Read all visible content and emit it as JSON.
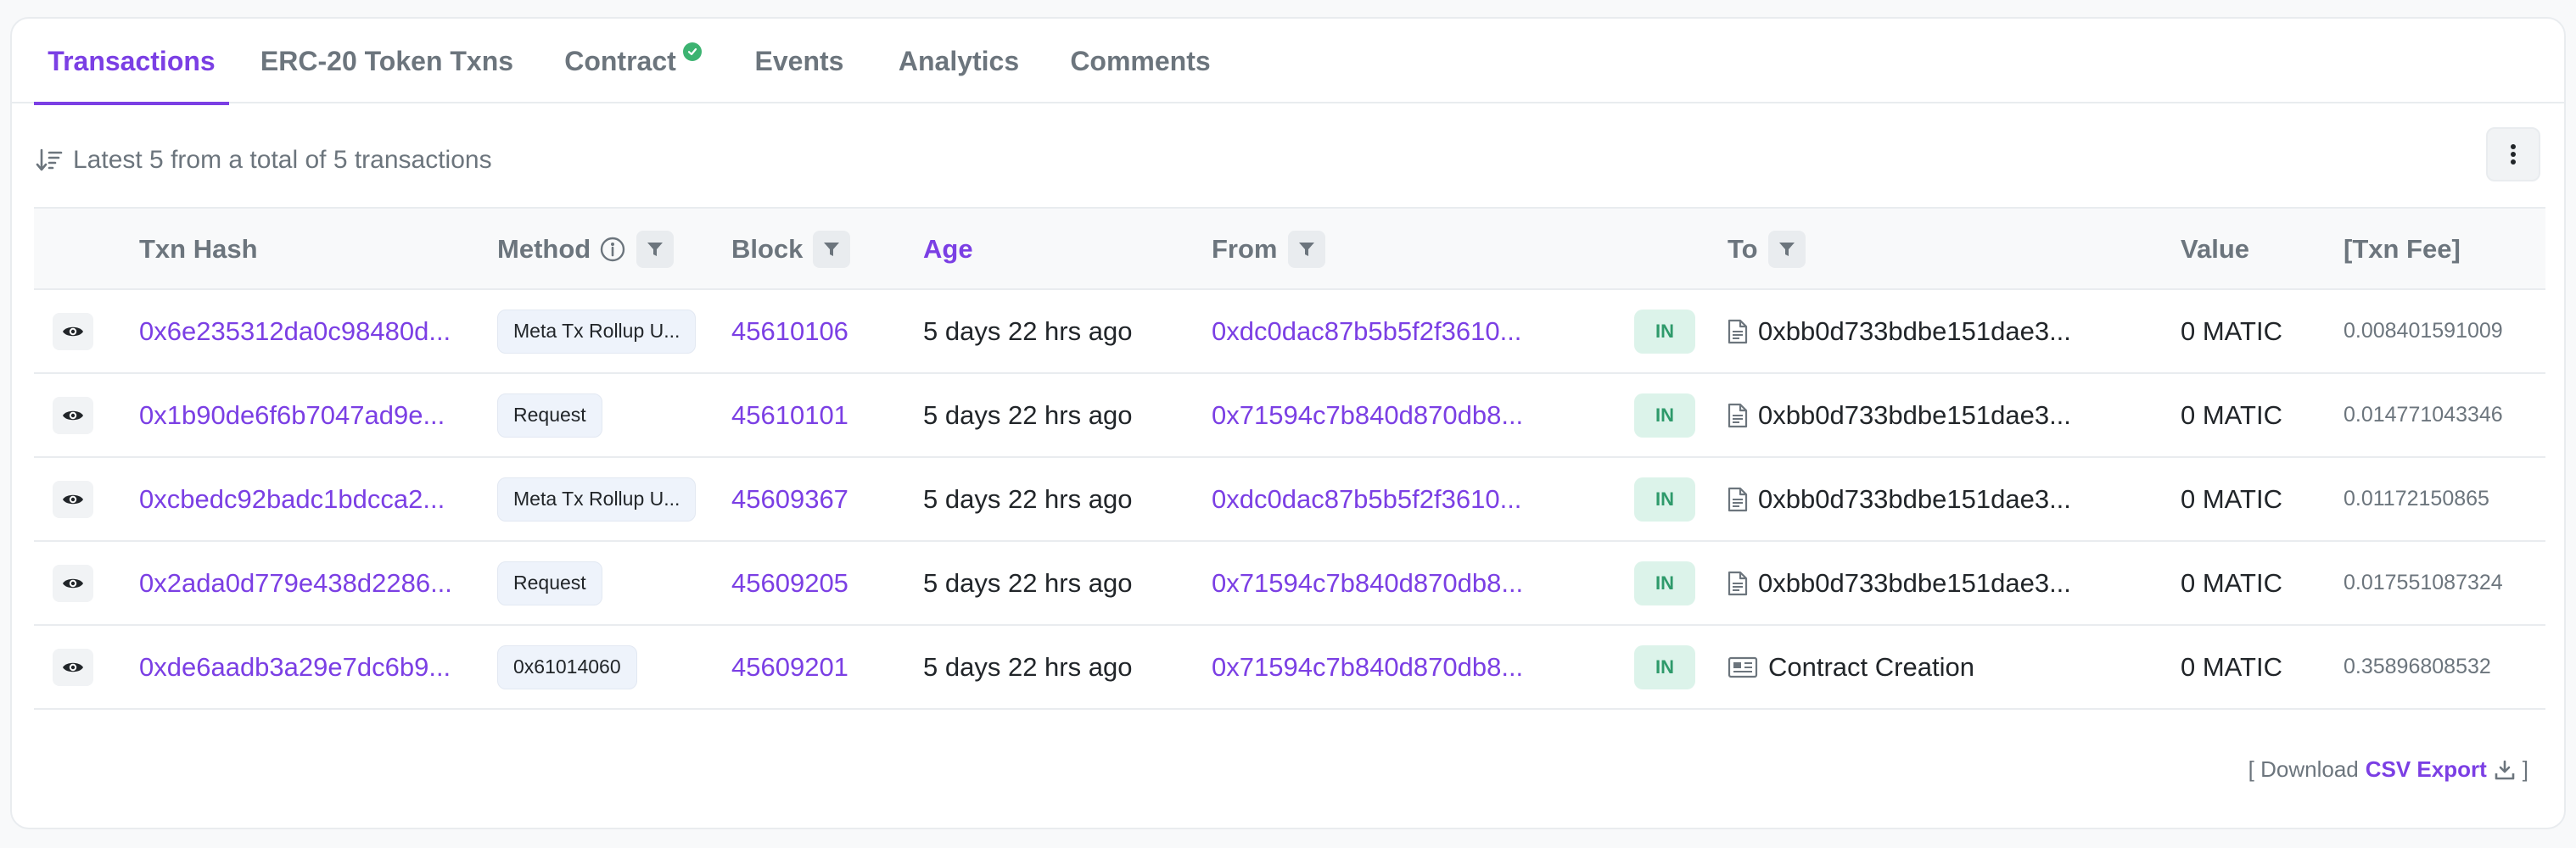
{
  "tabs": [
    {
      "label": "Transactions",
      "active": true
    },
    {
      "label": "ERC-20 Token Txns",
      "active": false
    },
    {
      "label": "Contract",
      "active": false,
      "verified": true
    },
    {
      "label": "Events",
      "active": false
    },
    {
      "label": "Analytics",
      "active": false
    },
    {
      "label": "Comments",
      "active": false
    }
  ],
  "summary": "Latest 5 from a total of 5 transactions",
  "columns": {
    "txn_hash": "Txn Hash",
    "method": "Method",
    "block": "Block",
    "age": "Age",
    "from": "From",
    "to": "To",
    "value": "Value",
    "txn_fee": "[Txn Fee]"
  },
  "rows": [
    {
      "hash": "0x6e235312da0c98480d...",
      "method": "Meta Tx Rollup U...",
      "block": "45610106",
      "age": "5 days 22 hrs ago",
      "from": "0xdc0dac87b5b5f2f3610...",
      "direction": "IN",
      "to": "0xbb0d733bdbe151dae3...",
      "to_icon": "document-icon",
      "value": "0 MATIC",
      "fee": "0.008401591009"
    },
    {
      "hash": "0x1b90de6f6b7047ad9e...",
      "method": "Request",
      "block": "45610101",
      "age": "5 days 22 hrs ago",
      "from": "0x71594c7b840d870db8...",
      "direction": "IN",
      "to": "0xbb0d733bdbe151dae3...",
      "to_icon": "document-icon",
      "value": "0 MATIC",
      "fee": "0.014771043346"
    },
    {
      "hash": "0xcbedc92badc1bdcca2...",
      "method": "Meta Tx Rollup U...",
      "block": "45609367",
      "age": "5 days 22 hrs ago",
      "from": "0xdc0dac87b5b5f2f3610...",
      "direction": "IN",
      "to": "0xbb0d733bdbe151dae3...",
      "to_icon": "document-icon",
      "value": "0 MATIC",
      "fee": "0.01172150865"
    },
    {
      "hash": "0x2ada0d779e438d2286...",
      "method": "Request",
      "block": "45609205",
      "age": "5 days 22 hrs ago",
      "from": "0x71594c7b840d870db8...",
      "direction": "IN",
      "to": "0xbb0d733bdbe151dae3...",
      "to_icon": "document-icon",
      "value": "0 MATIC",
      "fee": "0.017551087324"
    },
    {
      "hash": "0xde6aadb3a29e7dc6b9...",
      "method": "0x61014060",
      "block": "45609201",
      "age": "5 days 22 hrs ago",
      "from": "0x71594c7b840d870db8...",
      "direction": "IN",
      "to": "Contract Creation",
      "to_icon": "newspaper-icon",
      "value": "0 MATIC",
      "fee": "0.35896808532"
    }
  ],
  "footer": {
    "prefix": "[ Download",
    "link": "CSV Export",
    "suffix": "]"
  },
  "colors": {
    "accent": "#7b3fe4",
    "in_badge_bg": "#dcf3ea",
    "in_badge_text": "#2e9a6b",
    "verified": "#3cb371"
  }
}
